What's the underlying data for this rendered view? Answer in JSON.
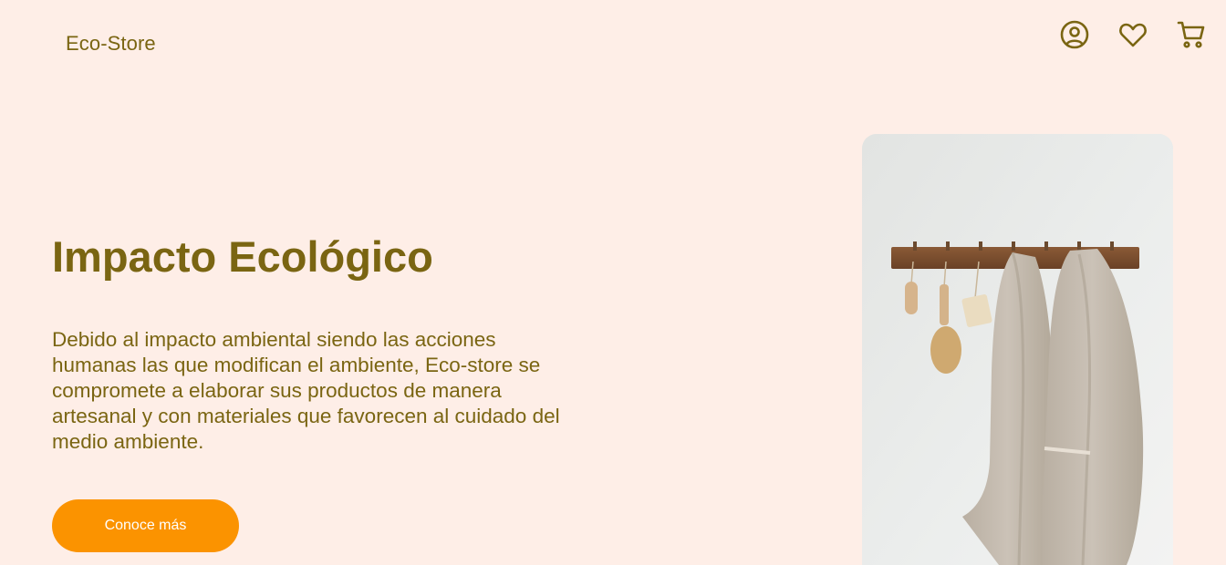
{
  "header": {
    "logo": "Eco-Store",
    "icons": [
      "user-icon",
      "heart-icon",
      "cart-icon"
    ]
  },
  "hero": {
    "title": "Impacto Ecológico",
    "description": "Debido al impacto ambiental siendo las acciones humanas las que modifican el ambiente, Eco-store se compromete a elaborar sus productos de manera artesanal y con materiales que favorecen al cuidado del medio ambiente.",
    "cta_label": "Conoce más"
  },
  "colors": {
    "background": "#feeee7",
    "brand_text": "#7a6512",
    "cta": "#fb9300"
  }
}
